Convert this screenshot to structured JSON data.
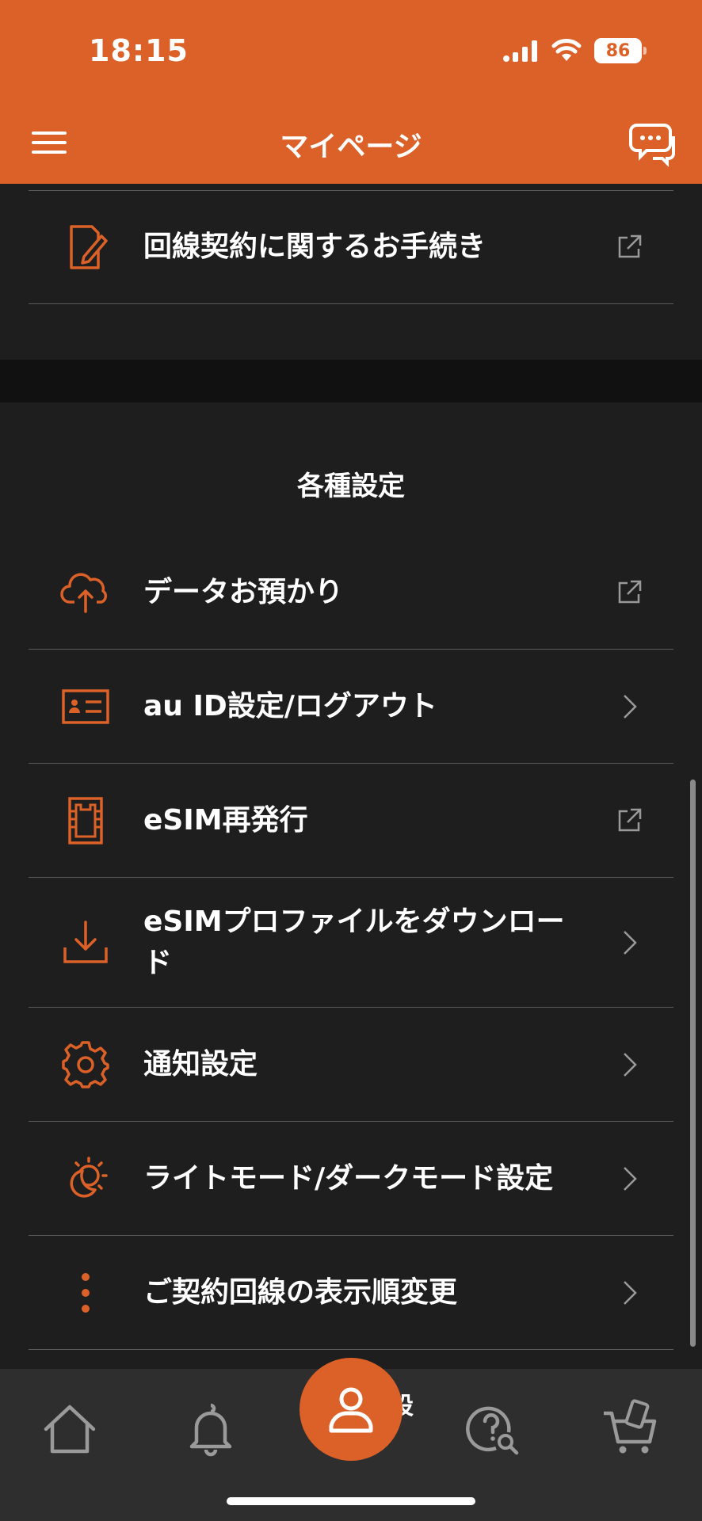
{
  "status_bar": {
    "time": "18:15",
    "battery": "86"
  },
  "header": {
    "title": "マイページ"
  },
  "top_rows": [
    {
      "label": "回線契約に関するお手続き",
      "icon": "document-pen-icon",
      "trailing": "external-link-icon"
    }
  ],
  "settings": {
    "title": "各種設定",
    "items": [
      {
        "label": "データお預かり",
        "icon": "cloud-upload-icon",
        "trailing": "external-link-icon"
      },
      {
        "label": "au ID設定/ログアウト",
        "icon": "id-card-icon",
        "trailing": "chevron-right-icon"
      },
      {
        "label": "eSIM再発行",
        "icon": "sim-card-icon",
        "trailing": "external-link-icon"
      },
      {
        "label": "eSIMプロファイルをダウンロード",
        "icon": "download-icon",
        "trailing": "chevron-right-icon"
      },
      {
        "label": "通知設定",
        "icon": "gear-icon",
        "trailing": "chevron-right-icon"
      },
      {
        "label": "ライトモード/ダークモード設定",
        "icon": "sun-moon-icon",
        "trailing": "chevron-right-icon"
      },
      {
        "label": "ご契約回線の表示順変更",
        "icon": "more-vertical-icon",
        "trailing": "chevron-right-icon"
      }
    ]
  },
  "tabbar": {
    "items": [
      "home-icon",
      "bell-icon",
      "user-icon",
      "help-search-icon",
      "cart-icon"
    ],
    "active": "user-icon",
    "partial_label": "設"
  },
  "colors": {
    "accent": "#dc6128",
    "background": "#1e1e1e",
    "header": "#dc6128"
  }
}
